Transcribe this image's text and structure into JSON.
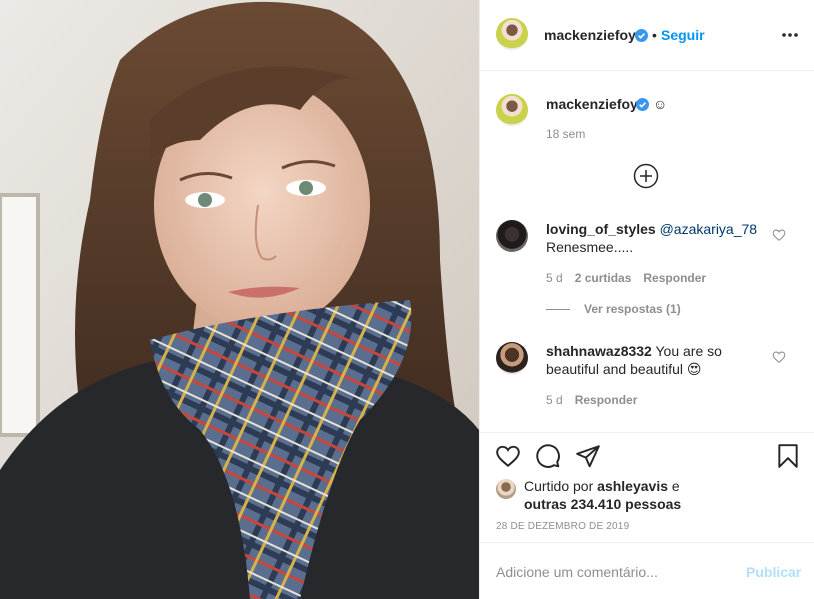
{
  "post": {
    "author": "mackenziefoy",
    "follow_label": "Seguir",
    "separator": "•",
    "caption": "☺",
    "caption_time": "18 sem",
    "date": "28 DE DEZEMBRO DE 2019"
  },
  "comments": [
    {
      "user": "loving_of_styles",
      "mention": "@azakariya_78",
      "text": "Renesmee.....",
      "time": "5 d",
      "likes": "2 curtidas",
      "reply_label": "Responder",
      "view_replies": "Ver respostas (1)"
    },
    {
      "user": "shahnawaz8332",
      "text": "You are so beautiful and beautiful 😍",
      "time": "5 d",
      "reply_label": "Responder"
    }
  ],
  "likes": {
    "prefix": "Curtido por",
    "user": "ashleyavis",
    "conj": "e",
    "others": "outras 234.410 pessoas"
  },
  "add_comment": {
    "placeholder": "Adicione um comentário...",
    "publish_label": "Publicar"
  },
  "colors": {
    "accent": "#0095f6",
    "verified": "#3897f0",
    "publish_disabled": "#b2dffc",
    "muted": "#8e8e8e"
  },
  "icons": [
    "verified-badge-icon",
    "more-options-icon",
    "add-circle-icon",
    "heart-icon",
    "comment-icon",
    "share-icon",
    "bookmark-icon"
  ]
}
